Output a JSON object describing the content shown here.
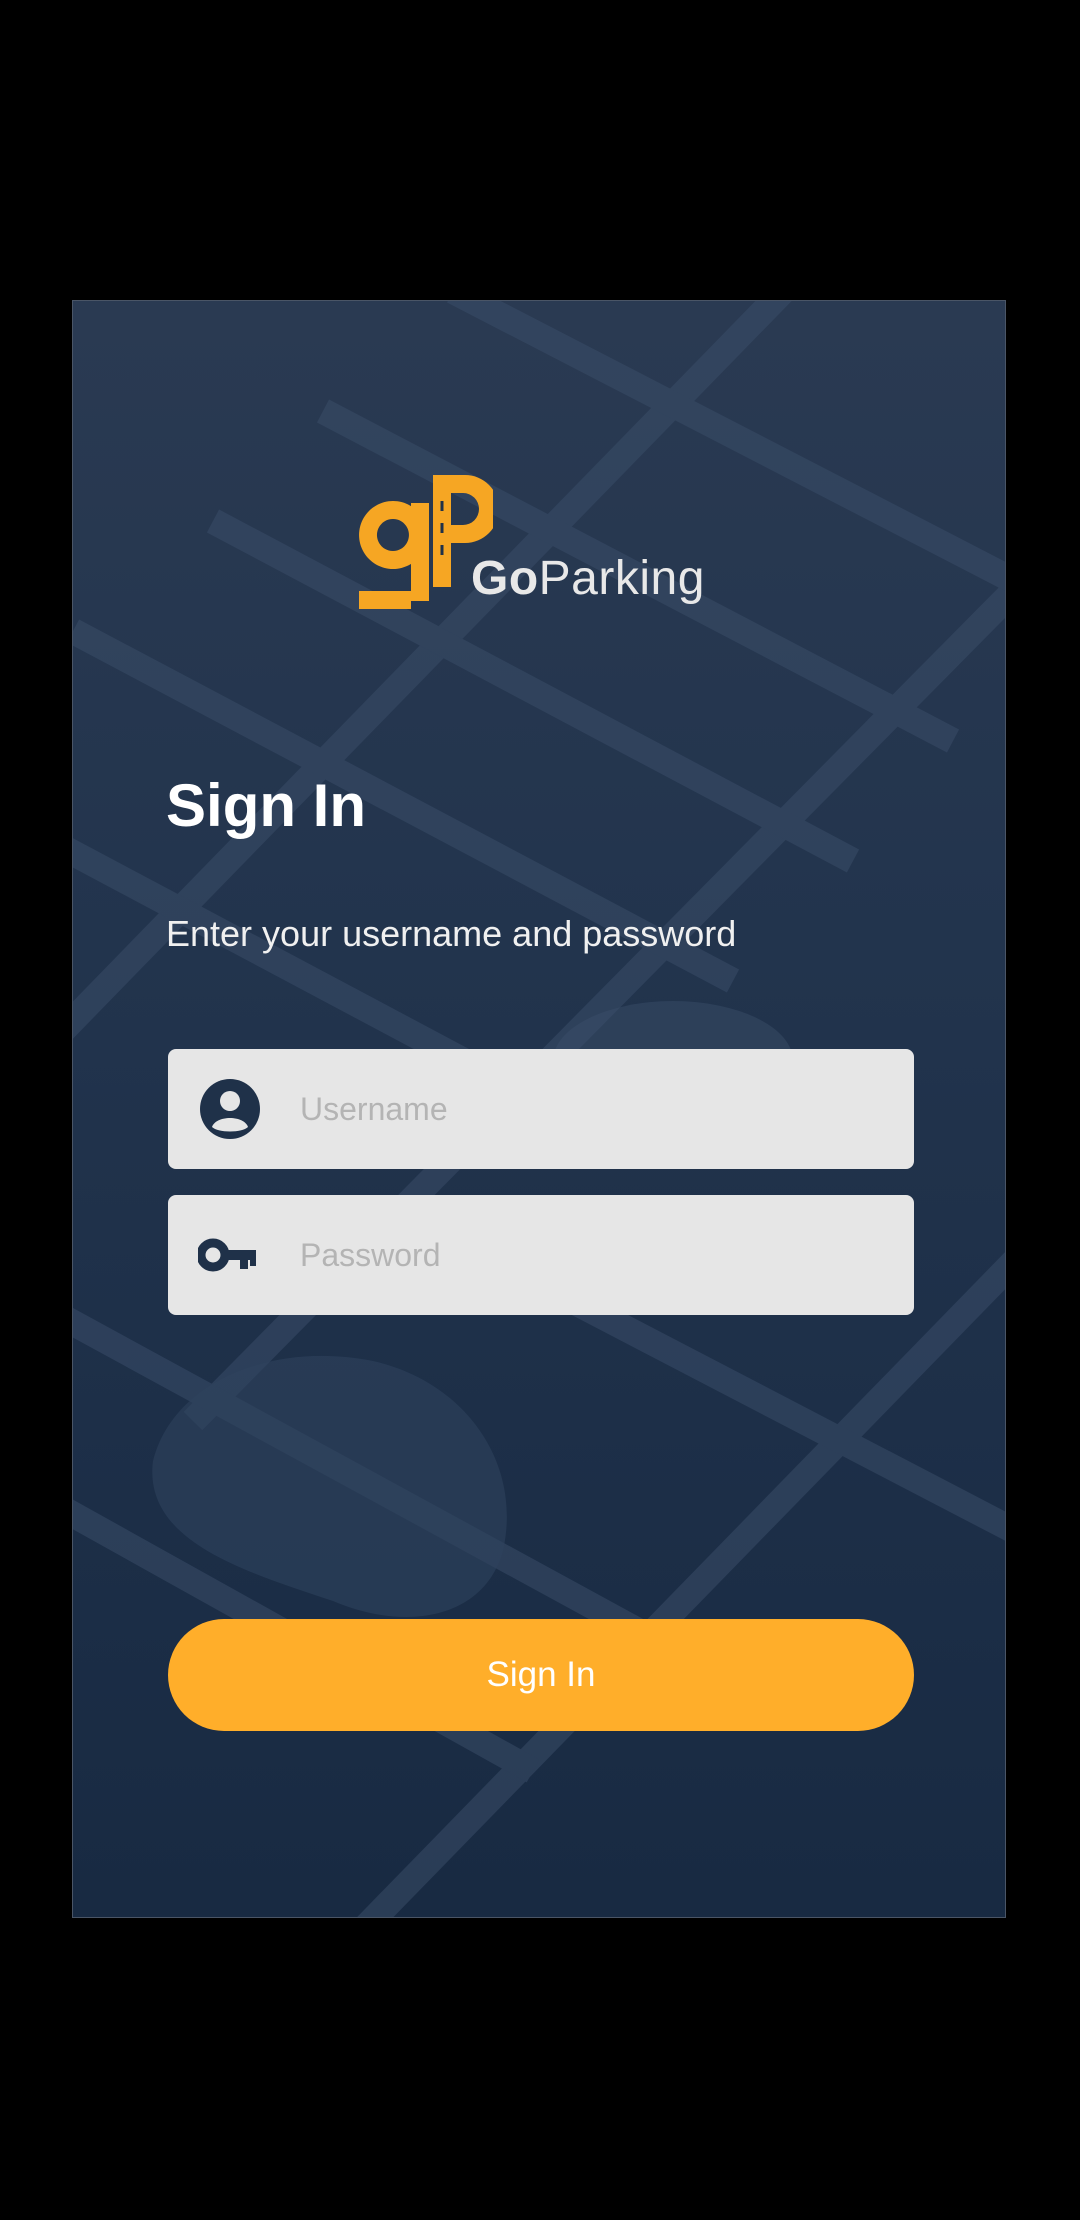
{
  "brand": {
    "name_bold": "Go",
    "name_rest": "Parking",
    "logo_letters": "gP",
    "accent_color": "#F6A623"
  },
  "signin": {
    "title": "Sign In",
    "subtitle": "Enter your username and password",
    "username": {
      "icon": "account-circle-icon",
      "placeholder": "Username",
      "value": ""
    },
    "password": {
      "icon": "key-icon",
      "placeholder": "Password",
      "value": ""
    },
    "button_label": "Sign In",
    "button_color": "#FFAE2A"
  },
  "theme": {
    "background": "#1F3149",
    "field_background": "#E6E6E6",
    "text_color": "#FFFFFF"
  }
}
